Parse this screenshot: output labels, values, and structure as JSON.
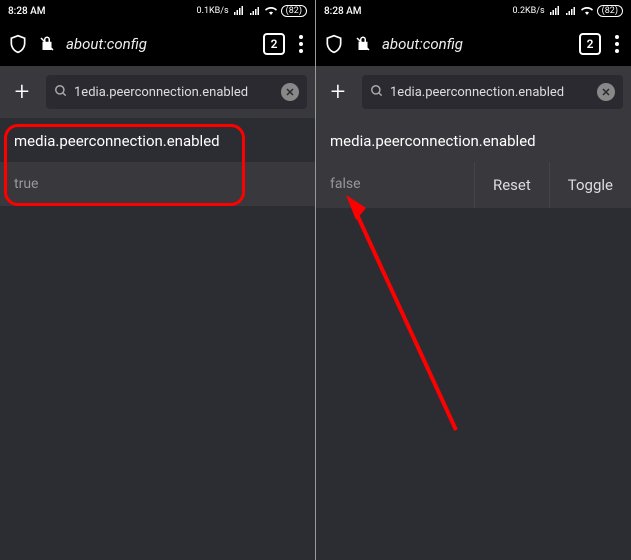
{
  "left": {
    "status": {
      "time": "8:28 AM",
      "speed": "0.1KB/s",
      "battery": "82"
    },
    "nav": {
      "url": "about:config",
      "tabs": "2"
    },
    "search": {
      "text": "1edia.peerconnection.enabled"
    },
    "pref": {
      "name": "media.peerconnection.enabled",
      "value": "true"
    }
  },
  "right": {
    "status": {
      "time": "8:28 AM",
      "speed": "0.2KB/s",
      "battery": "82"
    },
    "nav": {
      "url": "about:config",
      "tabs": "2"
    },
    "search": {
      "text": "1edia.peerconnection.enabled"
    },
    "pref": {
      "name": "media.peerconnection.enabled",
      "value": "false",
      "reset": "Reset",
      "toggle": "Toggle"
    }
  }
}
